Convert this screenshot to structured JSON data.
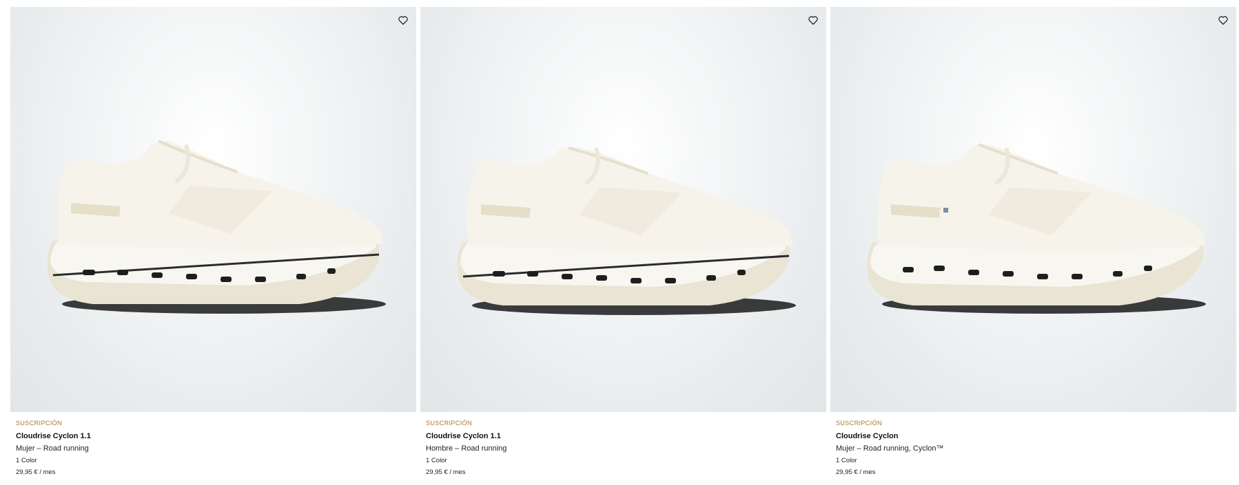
{
  "products": [
    {
      "tag": "SUSCRIPCIÓN",
      "name": "Cloudrise Cyclon 1.1",
      "category": "Mujer – Road running",
      "colors": "1 Color",
      "price": "29,95 € / mes",
      "image_icon": "white-running-shoe-image",
      "favorite_icon": "heart-outline-icon"
    },
    {
      "tag": "SUSCRIPCIÓN",
      "name": "Cloudrise Cyclon 1.1",
      "category": "Hombre – Road running",
      "colors": "1 Color",
      "price": "29,95 € / mes",
      "image_icon": "white-running-shoe-image",
      "favorite_icon": "heart-outline-icon"
    },
    {
      "tag": "SUSCRIPCIÓN",
      "name": "Cloudrise Cyclon",
      "category": "Mujer – Road running, Cyclon™",
      "colors": "1 Color",
      "price": "29,95 € / mes",
      "image_icon": "white-running-shoe-image",
      "favorite_icon": "heart-outline-icon"
    }
  ],
  "colors": {
    "tag": "#a7772b",
    "text": "#111111",
    "image_bg": "#e8ebed"
  }
}
